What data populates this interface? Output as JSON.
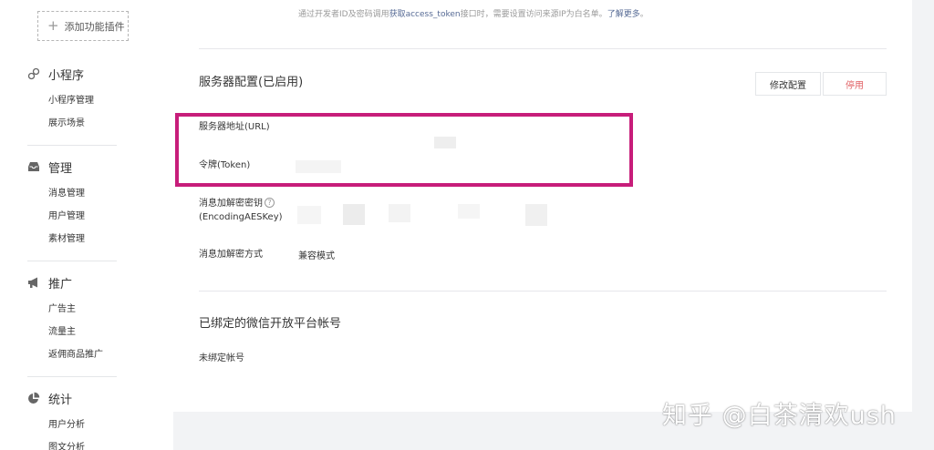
{
  "sidebar": {
    "add_plugin_label": "添加功能插件",
    "groups": [
      {
        "title": "小程序",
        "icon": "link-icon",
        "items": [
          "小程序管理",
          "展示场景"
        ]
      },
      {
        "title": "管理",
        "icon": "inbox-icon",
        "items": [
          "消息管理",
          "用户管理",
          "素材管理"
        ]
      },
      {
        "title": "推广",
        "icon": "megaphone-icon",
        "items": [
          "广告主",
          "流量主",
          "返佣商品推广"
        ]
      },
      {
        "title": "统计",
        "icon": "pie-chart-icon",
        "items": [
          "用户分析",
          "图文分析"
        ]
      }
    ]
  },
  "main": {
    "tip": {
      "prefix": "通过开发者ID及密码调用",
      "link1": "获取access_token",
      "middle": "接口时，需要设置访问来源IP为白名单。",
      "link2": "了解更多",
      "suffix": "。"
    },
    "server_config": {
      "title": "服务器配置(已启用)",
      "edit_button": "修改配置",
      "disable_button": "停用",
      "rows": {
        "url_label": "服务器地址(URL)",
        "token_label": "令牌(Token)",
        "aeskey_label_line1": "消息加解密密钥",
        "aeskey_label_line2": "(EncodingAESKey)",
        "encrypt_mode_label": "消息加解密方式",
        "encrypt_mode_value": "兼容模式"
      }
    },
    "bound_account": {
      "title": "已绑定的微信开放平台帐号",
      "value": "未绑定帐号"
    }
  },
  "watermark": "知乎 @白茶清欢ush",
  "colors": {
    "highlight": "#c71d7a",
    "link": "#576b95",
    "danger": "#e15f63"
  }
}
